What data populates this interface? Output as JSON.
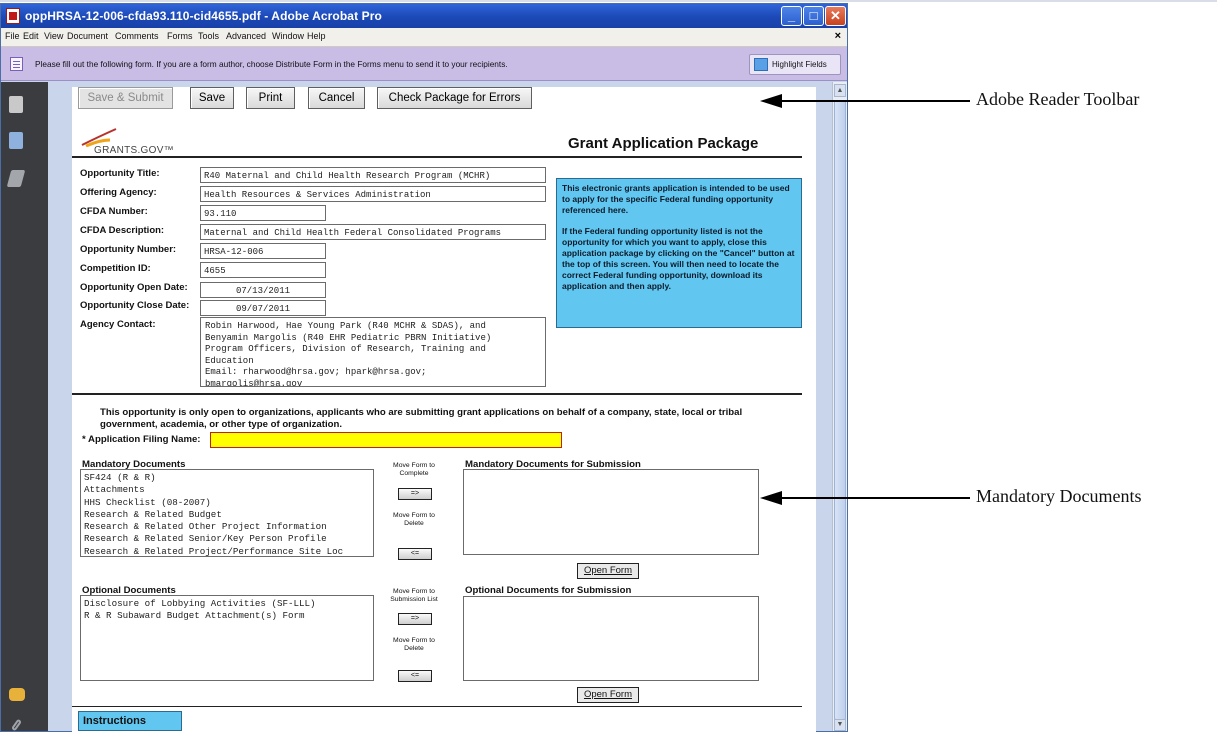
{
  "window": {
    "title": "oppHRSA-12-006-cfda93.110-cid4655.pdf - Adobe Acrobat Pro",
    "controls": {
      "minimize": "_",
      "maximize": "□",
      "close": "✕"
    }
  },
  "menu": {
    "items": [
      "File",
      "Edit",
      "View",
      "Document",
      "Comments",
      "Forms",
      "Tools",
      "Advanced",
      "Window",
      "Help"
    ],
    "close": "×"
  },
  "form_bar": {
    "message": "Please fill out the following form. If you are a form author, choose Distribute Form in the Forms menu to send it to your recipients.",
    "highlight_button": "Highlight Fields"
  },
  "side_icons": [
    "pages-icon",
    "bookmarks-icon",
    "signature-icon",
    "comment-icon",
    "attachment-icon"
  ],
  "toolbar": {
    "save_submit": "Save & Submit",
    "save": "Save",
    "print": "Print",
    "cancel": "Cancel",
    "check": "Check Package for Errors"
  },
  "header": {
    "logo_text": "GRANTS.GOV™",
    "title": "Grant Application Package"
  },
  "fields": {
    "opportunity_title": {
      "label": "Opportunity Title:",
      "value": "R40 Maternal and Child Health Research Program (MCHR)"
    },
    "offering_agency": {
      "label": "Offering Agency:",
      "value": "Health Resources & Services Administration"
    },
    "cfda_number": {
      "label": "CFDA Number:",
      "value": "93.110"
    },
    "cfda_description": {
      "label": "CFDA Description:",
      "value": "Maternal and Child Health Federal Consolidated Programs"
    },
    "opportunity_number": {
      "label": "Opportunity Number:",
      "value": "HRSA-12-006"
    },
    "competition_id": {
      "label": "Competition ID:",
      "value": "4655"
    },
    "open_date": {
      "label": "Opportunity Open Date:",
      "value": "07/13/2011"
    },
    "close_date": {
      "label": "Opportunity Close Date:",
      "value": "09/07/2011"
    },
    "agency_contact": {
      "label": "Agency Contact:",
      "lines": [
        "Robin Harwood, Hae Young Park (R40 MCHR & SDAS), and",
        "Benyamin Margolis (R40 EHR Pediatric PBRN Initiative)",
        "Program Officers, Division of Research, Training and",
        "Education",
        "Email:  rharwood@hrsa.gov; hpark@hrsa.gov;",
        "bmargolis@hrsa.gov"
      ]
    }
  },
  "info_box": {
    "para1": "This electronic grants application is intended to be used to apply for the specific Federal funding opportunity referenced here.",
    "para2": "If the Federal funding opportunity listed is not the opportunity for which you want to apply, close this application package by clicking on the \"Cancel\" button at the top of this screen. You will then need to locate the correct Federal funding opportunity, download its application and then apply."
  },
  "notice": "This opportunity is only open to organizations, applicants who are submitting grant applications on behalf of a company, state, local or tribal government, academia, or other type of organization.",
  "filing": {
    "label": "* Application Filing Name:",
    "value": ""
  },
  "mandatory": {
    "title": "Mandatory Documents",
    "items": [
      "SF424 (R & R)",
      "Attachments",
      "HHS Checklist (08-2007)",
      "Research & Related Budget",
      "Research & Related Other Project Information",
      "Research & Related Senior/Key Person Profile",
      "Research & Related Project/Performance Site Loc"
    ],
    "move_complete": "Move Form to Complete",
    "move_delete": "Move Form to Delete",
    "add_btn": "=>",
    "remove_btn": "<=",
    "submission_title": "Mandatory Documents for Submission",
    "open_form": "Open Form"
  },
  "optional": {
    "title": "Optional Documents",
    "items": [
      "Disclosure of Lobbying Activities (SF-LLL)",
      "R & R Subaward Budget Attachment(s) Form"
    ],
    "move_submission": "Move Form to Submission List",
    "move_delete": "Move Form to Delete",
    "add_btn": "=>",
    "remove_btn": "<=",
    "submission_title": "Optional Documents for Submission",
    "open_form": "Open Form"
  },
  "instructions": "Instructions",
  "annotations": {
    "toolbar": "Adobe Reader Toolbar",
    "mandatory": "Mandatory Documents"
  },
  "colors": {
    "titlebar": "#1c49b7",
    "form_bar": "#c9bde6",
    "info_box": "#62c7f0",
    "filing_highlight": "#ffff00"
  }
}
